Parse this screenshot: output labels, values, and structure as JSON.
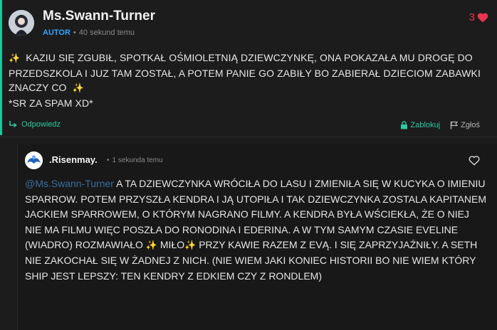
{
  "main_comment": {
    "author": "Ms.Swann-Turner",
    "badge": "AUTOR",
    "timestamp": "40 sekund temu",
    "likes": "3",
    "text": "KAZIU SIĘ ZGUBIŁ, SPOTKAŁ OŚMIOLETNIĄ DZIEWCZYNKĘ, ONA POKAZAŁA MU DROGĘ DO PRZEDSZKOLA I JUZ TAM ZOSTAŁ, A POTEM PANIE GO ZABIŁY BO ZABIERAŁ DZIECIOM ZABAWKI ZNACZY CO",
    "text_line2": "*SR ZA SPAM XD*",
    "reply_label": "Odpowiedz",
    "block_label": "Zablokuj",
    "report_label": "Zgłoś"
  },
  "reply": {
    "author": ".Risenmay.",
    "timestamp": "1 sekunda temu",
    "mention": "@Ms.Swann-Turner",
    "text_part1": "A TA DZIEWCZYNKA WRÓCIŁA DO LASU I ZMIENIŁA SIĘ W KUCYKA O IMIENIU SPARROW. POTEM PRZYSZŁA KENDRA I JĄ UTOPIŁA I TAK DZIEWCZYNKA ZOSTALA KAPITANEM JACKIEM SPARROWEM, O KTÓRYM NAGRANO FILMY. A KENDRA BYŁA WŚCIEKŁA, ŻE O NIEJ NIE MA FILMU WIĘC POSZŁA DO RONODINA I EDERINA. A W TYM SAMYM CZASIE EVELINE (WIADRO) ROZMAWIAŁO",
    "text_milo": "MIŁO",
    "text_part2": "PRZY KAWIE RAZEM Z EVĄ. I SIĘ ZAPRZYJAŹNIŁY. A SETH NIE ZAKOCHAŁ SIĘ W ŻADNEJ Z NICH. (NIE WIEM JAKI KONIEC HISTORII BO NIE WIEM KTÓRY SHIP JEST LEPSZY: TEN KENDRY Z EDKIEM CZY Z RONDLEM)"
  },
  "icons": {
    "sparkle": "✨"
  },
  "colors": {
    "accent": "#1fc49a",
    "author_badge": "#35a3ff",
    "like": "#e8344e",
    "mention": "#3a6fa0"
  }
}
